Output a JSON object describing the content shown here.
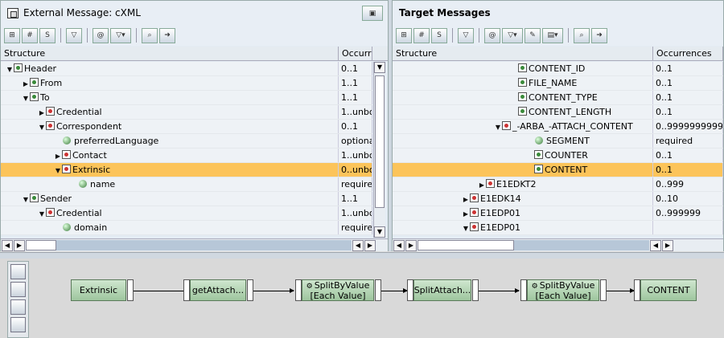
{
  "left": {
    "title": "External Message: cXML",
    "col_structure": "Structure",
    "col_occ": "Occurre",
    "rows": [
      {
        "exp": "down",
        "icon": "node",
        "label": "Header",
        "occ": "0..1",
        "lvl": 0
      },
      {
        "exp": "right",
        "icon": "node",
        "label": "From",
        "occ": "1..1",
        "lvl": 1
      },
      {
        "exp": "down",
        "icon": "node",
        "label": "To",
        "occ": "1..1",
        "lvl": 1
      },
      {
        "exp": "right",
        "icon": "red",
        "label": "Credential",
        "occ": "1..unbo",
        "lvl": 2
      },
      {
        "exp": "down",
        "icon": "red",
        "label": "Correspondent",
        "occ": "0..1",
        "lvl": 2
      },
      {
        "exp": "",
        "icon": "attr",
        "label": "preferredLanguage",
        "occ": "optiona",
        "lvl": 3
      },
      {
        "exp": "right",
        "icon": "red",
        "label": "Contact",
        "occ": "1..unbo",
        "lvl": 3
      },
      {
        "exp": "down",
        "icon": "red",
        "label": "Extrinsic",
        "occ": "0..unbo",
        "lvl": 3,
        "sel": true
      },
      {
        "exp": "",
        "icon": "attr",
        "label": "name",
        "occ": "require",
        "lvl": 4
      },
      {
        "exp": "down",
        "icon": "node",
        "label": "Sender",
        "occ": "1..1",
        "lvl": 1
      },
      {
        "exp": "down",
        "icon": "red",
        "label": "Credential",
        "occ": "1..unbo",
        "lvl": 2
      },
      {
        "exp": "",
        "icon": "attr",
        "label": "domain",
        "occ": "require",
        "lvl": 3
      }
    ]
  },
  "right": {
    "title": "Target Messages",
    "col_structure": "Structure",
    "col_occ": "Occurrences",
    "rows": [
      {
        "exp": "",
        "icon": "node",
        "label": "CONTENT_ID",
        "occ": "0..1",
        "lvl": 7
      },
      {
        "exp": "",
        "icon": "node",
        "label": "FILE_NAME",
        "occ": "0..1",
        "lvl": 7
      },
      {
        "exp": "",
        "icon": "node",
        "label": "CONTENT_TYPE",
        "occ": "0..1",
        "lvl": 7
      },
      {
        "exp": "",
        "icon": "node",
        "label": "CONTENT_LENGTH",
        "occ": "0..1",
        "lvl": 7
      },
      {
        "exp": "down",
        "icon": "red",
        "label": "_-ARBA_-ATTACH_CONTENT",
        "occ": "0..9999999999",
        "lvl": 6
      },
      {
        "exp": "",
        "icon": "attr",
        "label": "SEGMENT",
        "occ": "required",
        "lvl": 8
      },
      {
        "exp": "",
        "icon": "node",
        "label": "COUNTER",
        "occ": "0..1",
        "lvl": 8
      },
      {
        "exp": "",
        "icon": "node",
        "label": "CONTENT",
        "occ": "0..1",
        "lvl": 8,
        "sel": true
      },
      {
        "exp": "right",
        "icon": "red",
        "label": "E1EDKT2",
        "occ": "0..999",
        "lvl": 5
      },
      {
        "exp": "right",
        "icon": "red",
        "label": "E1EDK14",
        "occ": "0..10",
        "lvl": 4
      },
      {
        "exp": "right",
        "icon": "red",
        "label": "E1EDP01",
        "occ": "0..999999",
        "lvl": 4
      },
      {
        "exp": "down",
        "icon": "red",
        "label": "E1EDP01",
        "occ": "",
        "lvl": 4
      }
    ]
  },
  "mapping": {
    "n1": "Extrinsic",
    "n2": "getAttach...",
    "n3a": "SplitByValue",
    "n3b": "[Each Value]",
    "n4": "SplitAttach...",
    "n5a": "SplitByValue",
    "n5b": "[Each Value]",
    "n6": "CONTENT"
  },
  "icons": {
    "left_toolbar": [
      "tree-icon",
      "grid-icon",
      "src-icon",
      "filter-funnel-icon",
      "occurrence-icon",
      "filter-dropdown-icon",
      "binoculars-icon",
      "navigate-icon"
    ],
    "right_toolbar": [
      "tree-icon",
      "grid-icon",
      "src-icon",
      "filter-funnel-icon",
      "occurrence-icon",
      "filter-dropdown-icon",
      "edit-icon",
      "doc-dropdown-icon",
      "binoculars-icon",
      "navigate-icon"
    ]
  },
  "colors": {
    "selected": "#fcc45a",
    "node_green": "#9ec69e"
  }
}
